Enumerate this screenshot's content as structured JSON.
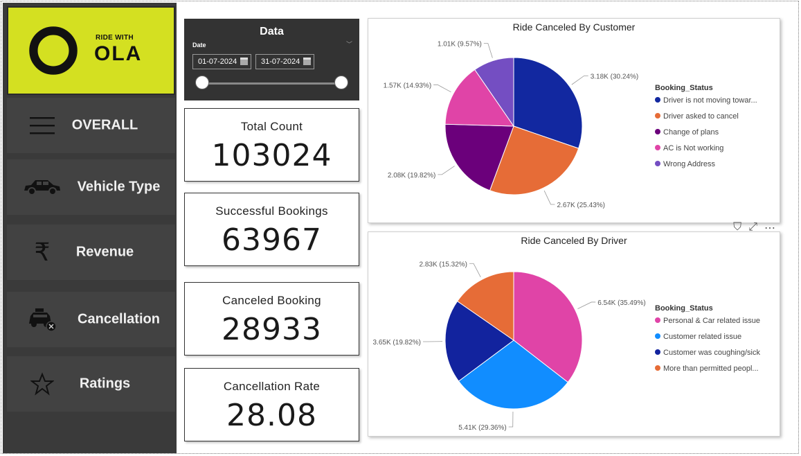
{
  "logo": {
    "line1": "RIDE WITH",
    "line2": "OLA"
  },
  "nav": [
    {
      "label": "OVERALL",
      "icon": "menu-icon"
    },
    {
      "label": "Vehicle Type",
      "icon": "car-icon"
    },
    {
      "label": "Revenue",
      "icon": "rupee-icon"
    },
    {
      "label": "Cancellation",
      "icon": "taxi-cancel-icon"
    },
    {
      "label": "Ratings",
      "icon": "star-icon"
    }
  ],
  "filter": {
    "title": "Data",
    "field": "Date",
    "start": "01-07-2024",
    "end": "31-07-2024"
  },
  "kpis": [
    {
      "label": "Total Count",
      "value": "103024"
    },
    {
      "label": "Successful Bookings",
      "value": "63967"
    },
    {
      "label": "Canceled Booking",
      "value": "28933"
    },
    {
      "label": "Cancellation Rate",
      "value": "28.08"
    }
  ],
  "chart_data": [
    {
      "type": "pie",
      "title": "Ride Canceled By Customer",
      "legend_title": "Booking_Status",
      "legend_position": "right",
      "slices": [
        {
          "name": "Driver is not moving towar...",
          "value": 3.18,
          "label": "3.18K (30.24%)",
          "color": "#1228a0"
        },
        {
          "name": "Driver asked to cancel",
          "value": 2.67,
          "label": "2.67K (25.43%)",
          "color": "#e66c37"
        },
        {
          "name": "Change of plans",
          "value": 2.08,
          "label": "2.08K (19.82%)",
          "color": "#6b007b"
        },
        {
          "name": "AC is Not working",
          "value": 1.57,
          "label": "1.57K (14.93%)",
          "color": "#e044a7"
        },
        {
          "name": "Wrong Address",
          "value": 1.01,
          "label": "1.01K (9.57%)",
          "color": "#744ec2"
        }
      ]
    },
    {
      "type": "pie",
      "title": "Ride Canceled By Driver",
      "legend_title": "Booking_Status",
      "legend_position": "right",
      "slices": [
        {
          "name": "Personal & Car related issue",
          "value": 6.54,
          "label": "6.54K (35.49%)",
          "color": "#e044a7"
        },
        {
          "name": "Customer related issue",
          "value": 5.41,
          "label": "5.41K (29.36%)",
          "color": "#118dff"
        },
        {
          "name": "Customer was coughing/sick",
          "value": 3.65,
          "label": "3.65K (19.82%)",
          "color": "#12239e"
        },
        {
          "name": "More than permitted peopl...",
          "value": 2.83,
          "label": "2.83K (15.32%)",
          "color": "#e66c37"
        }
      ]
    }
  ]
}
